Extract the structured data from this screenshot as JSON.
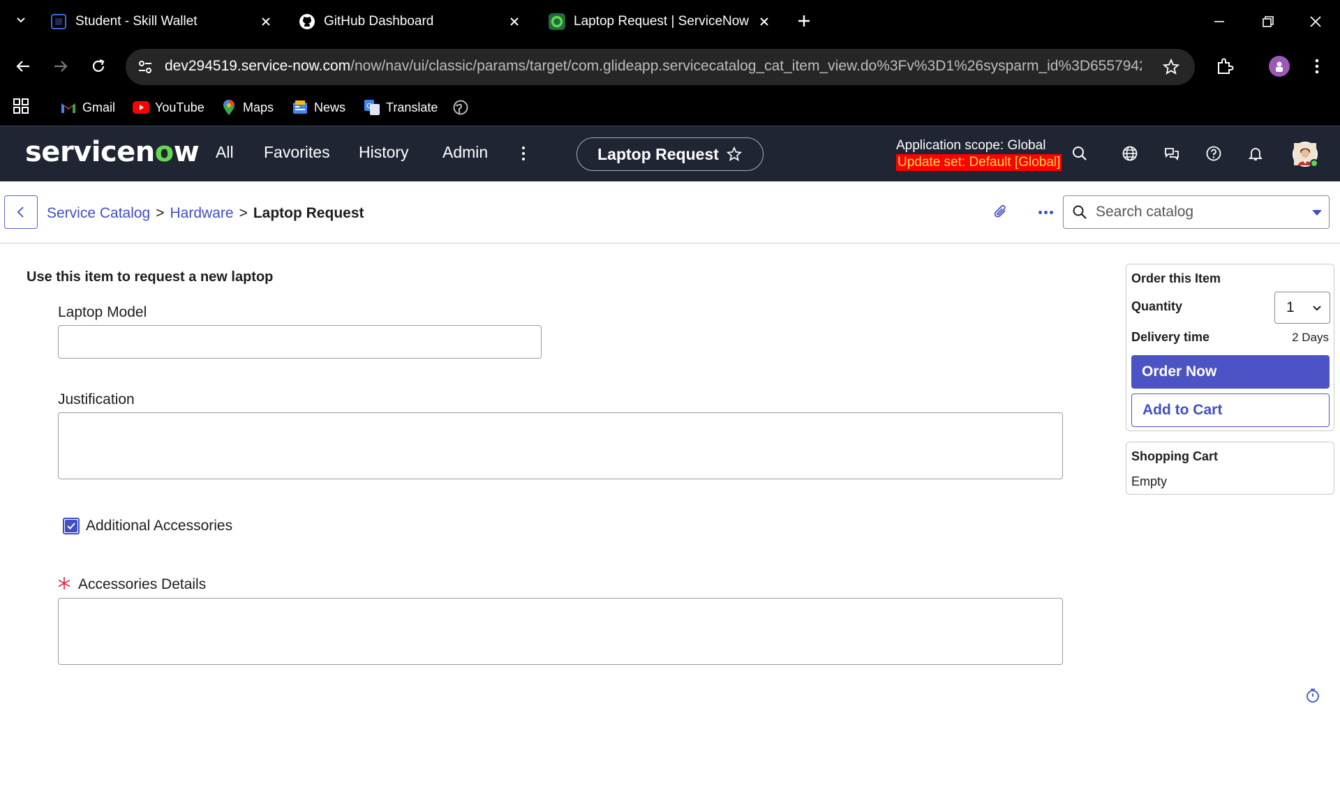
{
  "browser": {
    "tabs": [
      {
        "title": "Student - Skill Wallet",
        "icon": "skill-wallet-icon"
      },
      {
        "title": "GitHub Dashboard",
        "icon": "github-icon"
      },
      {
        "title": "Laptop Request | ServiceNow",
        "icon": "servicenow-icon",
        "active": true
      }
    ],
    "url_host": "dev294519.service-now.com",
    "url_path": "/now/nav/ui/classic/params/target/com.glideapp.servicecatalog_cat_item_view.do%3Fv%3D1%26sysparm_id%3D6557942...",
    "bookmarks": [
      {
        "label": "Gmail",
        "icon": "gmail-icon"
      },
      {
        "label": "YouTube",
        "icon": "youtube-icon"
      },
      {
        "label": "Maps",
        "icon": "maps-icon"
      },
      {
        "label": "News",
        "icon": "news-icon"
      },
      {
        "label": "Translate",
        "icon": "translate-icon"
      }
    ]
  },
  "header": {
    "logo_prefix": "servicen",
    "logo_o": "o",
    "logo_suffix": "w",
    "nav": [
      "All",
      "Favorites",
      "History",
      "Admin"
    ],
    "context_title": "Laptop Request",
    "scope_text": "Application scope: Global",
    "update_set_text": "Update set: Default [Global]",
    "colors": {
      "header_bg": "#1f2532",
      "logo_accent": "#62d84e",
      "update_set_bg": "#ff0000",
      "update_set_fg": "#ffe14d"
    }
  },
  "breadcrumb": {
    "items": [
      "Service Catalog",
      "Hardware"
    ],
    "separator": ">",
    "current": "Laptop Request"
  },
  "search": {
    "placeholder": "Search catalog",
    "value": ""
  },
  "form": {
    "intro": "Use this item to request a new laptop",
    "laptop_model": {
      "label": "Laptop Model",
      "value": ""
    },
    "justification": {
      "label": "Justification",
      "value": ""
    },
    "additional_accessories": {
      "label": "Additional Accessories",
      "checked": true
    },
    "accessories_details": {
      "label": "Accessories Details",
      "value": "",
      "required": true,
      "required_mark": "*"
    }
  },
  "order": {
    "title": "Order this Item",
    "quantity_label": "Quantity",
    "quantity_value": "1",
    "delivery_label": "Delivery time",
    "delivery_value": "2 Days",
    "order_now": "Order Now",
    "add_to_cart": "Add to Cart",
    "accent": "#4c53c4"
  },
  "cart": {
    "title": "Shopping Cart",
    "status": "Empty"
  }
}
